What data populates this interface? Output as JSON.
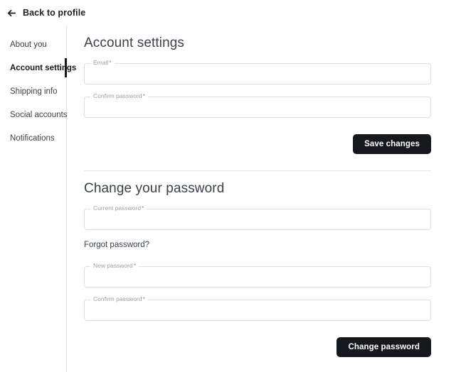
{
  "header": {
    "back_label": "Back to profile",
    "back_icon": "arrow-left-icon"
  },
  "sidebar": {
    "items": [
      {
        "label": "About you",
        "active": false
      },
      {
        "label": "Account settings",
        "active": true
      },
      {
        "label": "Shipping info",
        "active": false
      },
      {
        "label": "Social accounts",
        "active": false
      },
      {
        "label": "Notifications",
        "active": false
      }
    ]
  },
  "account_settings": {
    "title": "Account settings",
    "fields": [
      {
        "label": "Email",
        "required": "*",
        "value": "",
        "placeholder": ""
      },
      {
        "label": "Confirm password",
        "required": "*",
        "value": "",
        "placeholder": ""
      }
    ],
    "save_label": "Save changes"
  },
  "change_password": {
    "title": "Change your password",
    "current_field": {
      "label": "Current password",
      "required": "*",
      "value": "",
      "placeholder": ""
    },
    "forgot_label": "Forgot password?",
    "new_field": {
      "label": "New password",
      "required": "*",
      "value": "",
      "placeholder": ""
    },
    "confirm_field": {
      "label": "Confirm password",
      "required": "*",
      "value": "",
      "placeholder": ""
    },
    "submit_label": "Change password"
  },
  "colors": {
    "accent": "#15191e",
    "required_asterisk": "#e8734a",
    "border": "#dcdfe3",
    "divider": "#e3e7ea",
    "text": "#39424b"
  }
}
